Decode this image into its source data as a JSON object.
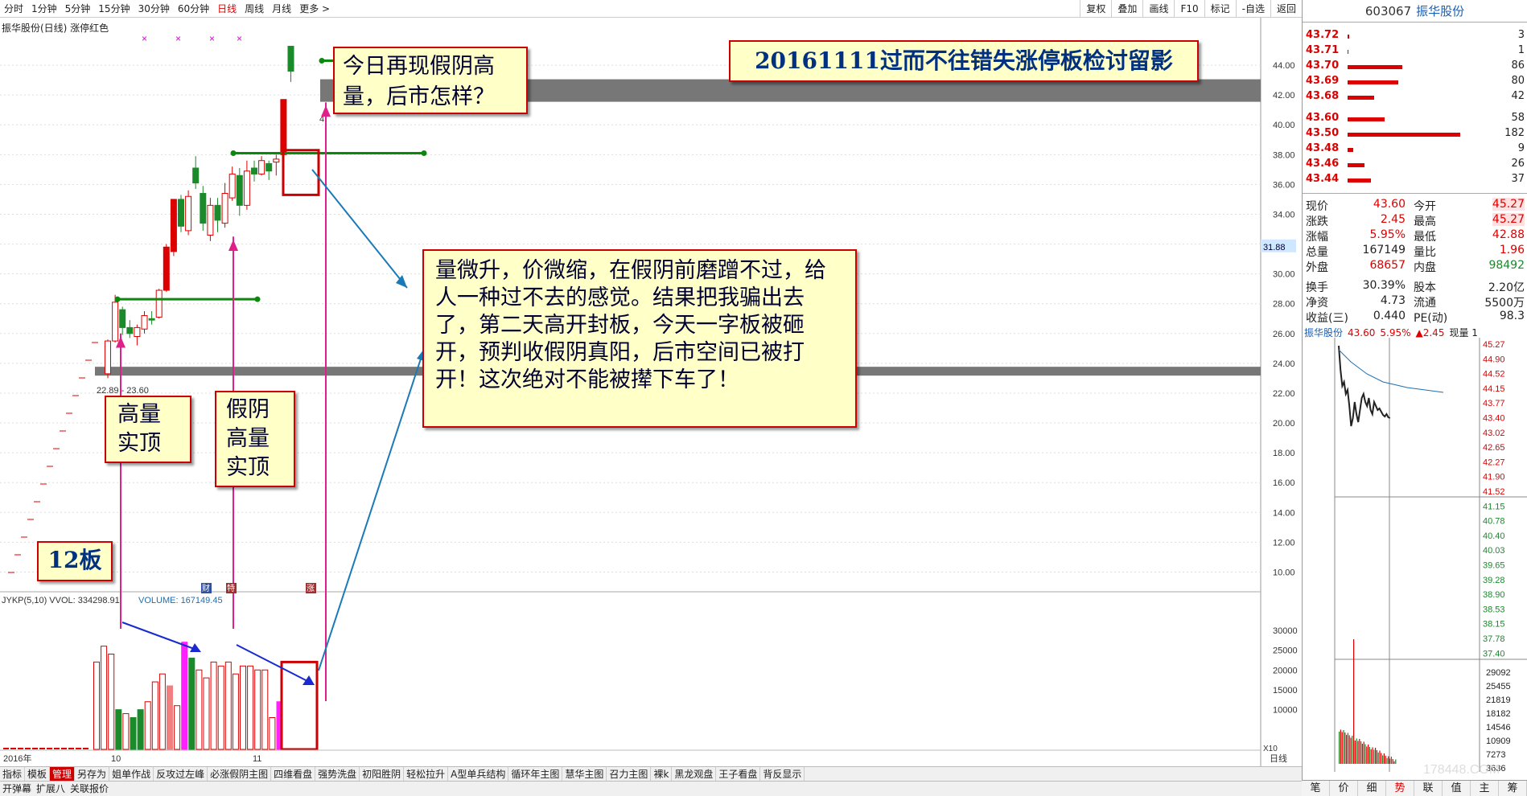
{
  "toolbar": {
    "tabs": [
      "分时",
      "1分钟",
      "5分钟",
      "15分钟",
      "30分钟",
      "60分钟",
      "日线",
      "周线",
      "月线",
      "更多 >"
    ],
    "active_tab": "日线",
    "right_buttons": [
      "复权",
      "叠加",
      "画线",
      "F10",
      "标记",
      "-自选",
      "返回"
    ]
  },
  "chart": {
    "title": "振华股份(日线) 涨停红色",
    "price_ticks": [
      "44.00",
      "42.00",
      "40.00",
      "38.00",
      "36.00",
      "34.00",
      "32.00",
      "30.00",
      "28.00",
      "26.00",
      "24.00",
      "22.00",
      "20.00",
      "18.00",
      "16.00",
      "14.00",
      "12.00",
      "10.00"
    ],
    "current_price_tag": "31.88",
    "gap_label": "22.89 - 23.60",
    "marker_4": "4",
    "volume_label": "JYKP(5,10)  VVOL: 334298.91",
    "volume_label2": "VOLUME: 167149.45",
    "volume_ticks": [
      "30000",
      "25000",
      "20000",
      "15000",
      "10000"
    ],
    "x_labels": [
      "2016年",
      "10",
      "11"
    ],
    "corner_label": "X10",
    "period_label": "日线",
    "event_badges": [
      "财",
      "特",
      "涨"
    ]
  },
  "chart_data": {
    "type": "candlestick",
    "ylim": [
      9,
      46
    ],
    "candles": [
      {
        "o": 23.3,
        "c": 25.5,
        "h": 25.6,
        "l": 23.0
      },
      {
        "o": 25.5,
        "c": 28.1,
        "h": 28.6,
        "l": 25.4
      },
      {
        "o": 27.6,
        "c": 26.4,
        "h": 27.8,
        "l": 25.9
      },
      {
        "o": 26.4,
        "c": 26.0,
        "h": 26.9,
        "l": 25.7
      },
      {
        "o": 25.8,
        "c": 26.4,
        "h": 26.6,
        "l": 25.2
      },
      {
        "o": 26.3,
        "c": 27.2,
        "h": 27.5,
        "l": 26.0
      },
      {
        "o": 27.0,
        "c": 26.9,
        "h": 27.5,
        "l": 26.6
      },
      {
        "o": 27.1,
        "c": 28.9,
        "h": 29.0,
        "l": 27.0
      },
      {
        "o": 28.9,
        "c": 31.8,
        "h": 32.0,
        "l": 28.8
      },
      {
        "o": 31.5,
        "c": 35.0,
        "h": 35.0,
        "l": 31.2
      },
      {
        "o": 35.0,
        "c": 33.2,
        "h": 35.3,
        "l": 32.8
      },
      {
        "o": 32.9,
        "c": 35.2,
        "h": 35.6,
        "l": 32.6
      },
      {
        "o": 37.1,
        "c": 36.1,
        "h": 37.9,
        "l": 35.7
      },
      {
        "o": 35.4,
        "c": 33.4,
        "h": 35.9,
        "l": 32.9
      },
      {
        "o": 32.6,
        "c": 34.6,
        "h": 35.1,
        "l": 32.2
      },
      {
        "o": 34.6,
        "c": 33.6,
        "h": 35.1,
        "l": 32.8
      },
      {
        "o": 33.4,
        "c": 35.4,
        "h": 36.1,
        "l": 33.1
      },
      {
        "o": 35.1,
        "c": 36.7,
        "h": 37.2,
        "l": 34.9
      },
      {
        "o": 36.6,
        "c": 34.6,
        "h": 37.1,
        "l": 33.9
      },
      {
        "o": 34.6,
        "c": 36.9,
        "h": 37.6,
        "l": 34.3
      },
      {
        "o": 37.1,
        "c": 36.7,
        "h": 37.6,
        "l": 36.2
      },
      {
        "o": 36.7,
        "c": 37.6,
        "h": 37.9,
        "l": 36.6
      },
      {
        "o": 37.4,
        "c": 36.9,
        "h": 37.6,
        "l": 36.3
      },
      {
        "o": 37.5,
        "c": 37.7,
        "h": 38.0,
        "l": 36.6
      },
      {
        "o": 38.0,
        "c": 41.7,
        "h": 41.7,
        "l": 37.9
      },
      {
        "o": 45.27,
        "c": 43.6,
        "h": 45.27,
        "l": 42.88
      }
    ],
    "volumes": [
      22,
      26,
      24,
      10,
      9,
      8,
      10,
      12,
      17,
      19,
      16,
      11,
      27,
      23,
      20,
      18,
      22,
      21,
      22,
      19,
      21,
      21,
      20,
      20,
      8,
      12
    ],
    "volume_colors": [
      "r",
      "r",
      "r",
      "g",
      "r",
      "g",
      "g",
      "r",
      "r",
      "r",
      "pink",
      "r",
      "mag",
      "g",
      "r",
      "r",
      "r",
      "r",
      "r",
      "r",
      "r",
      "r",
      "r",
      "r",
      "r",
      "mag"
    ],
    "hlines": [
      {
        "y": 23.3,
        "label": "gap"
      },
      {
        "y": 41.7,
        "label": "resist"
      }
    ]
  },
  "notes": {
    "title": "20161111过而不往错失涨停板检讨留影",
    "today": "今日再现假阴高量，后市怎样？",
    "main": "量微升，价微缩，在假阴前磨蹭不过，给人一种过不去的感觉。结果把我骗出去了，第二天高开封板，今天一字板被砸开，预判收假阴真阳，后市空间已被打开！这次绝对不能被撵下车了！",
    "high_vol": "高量实顶",
    "fake_yin": "假阴高量实顶",
    "boards": "12板"
  },
  "bottom_tabs": [
    "指标",
    "模板",
    "管理",
    "另存为",
    "姐单作战",
    "反攻过左峰",
    "必涨假阴主图",
    "四维看盘",
    "强势洗盘",
    "初阳胜阴",
    "轻松拉升",
    "A型单兵结构",
    "循环年主图",
    "慧华主图",
    "召力主图",
    "裸k",
    "黑龙观盘",
    "王子看盘",
    "背反显示"
  ],
  "bottom_tabs2": [
    "开弹幕",
    "扩展八",
    "关联报价"
  ],
  "right": {
    "code": "603067",
    "name": "振华股份",
    "orderbook": [
      {
        "p": "43.72",
        "v": "3",
        "w": 2
      },
      {
        "p": "43.71",
        "v": "1",
        "w": 1
      },
      {
        "p": "43.70",
        "v": "86",
        "w": 68
      },
      {
        "p": "43.69",
        "v": "80",
        "w": 63
      },
      {
        "p": "43.68",
        "v": "42",
        "w": 33
      },
      {
        "p": "43.60",
        "v": "58",
        "w": 46
      },
      {
        "p": "43.50",
        "v": "182",
        "w": 140
      },
      {
        "p": "43.48",
        "v": "9",
        "w": 7
      },
      {
        "p": "43.46",
        "v": "26",
        "w": 21
      },
      {
        "p": "43.44",
        "v": "37",
        "w": 29
      }
    ],
    "quote": [
      [
        "现价",
        "43.60",
        "今开",
        "45.27"
      ],
      [
        "涨跌",
        "2.45",
        "最高",
        "45.27"
      ],
      [
        "涨幅",
        "5.95%",
        "最低",
        "42.88"
      ],
      [
        "总量",
        "167149",
        "量比",
        "1.96"
      ],
      [
        "外盘",
        "68657",
        "内盘",
        "98492"
      ],
      [
        "换手",
        "30.39%",
        "股本",
        "2.20亿"
      ],
      [
        "净资",
        "4.73",
        "流通",
        "5500万"
      ],
      [
        "收益(三)",
        "0.440",
        "PE(动)",
        "98.3"
      ]
    ],
    "mini_header": [
      "振华股份",
      "43.60",
      "5.95%",
      "▲2.45",
      "现量 1"
    ],
    "mini_ticks": [
      "45.27",
      "44.90",
      "44.52",
      "44.15",
      "43.77",
      "43.40",
      "43.02",
      "42.65",
      "42.27",
      "41.90",
      "41.52",
      "41.15",
      "40.78",
      "40.40",
      "40.03",
      "39.65",
      "39.28",
      "38.90",
      "38.53",
      "38.15",
      "37.78",
      "37.40"
    ],
    "mini_vol_ticks": [
      "29092",
      "25455",
      "21819",
      "18182",
      "14546",
      "10909",
      "7273",
      "3636"
    ],
    "bottom_icons": [
      "笔",
      "价",
      "细",
      "势",
      "联",
      "值",
      "主",
      "筹"
    ],
    "watermark": "178448.COM"
  }
}
